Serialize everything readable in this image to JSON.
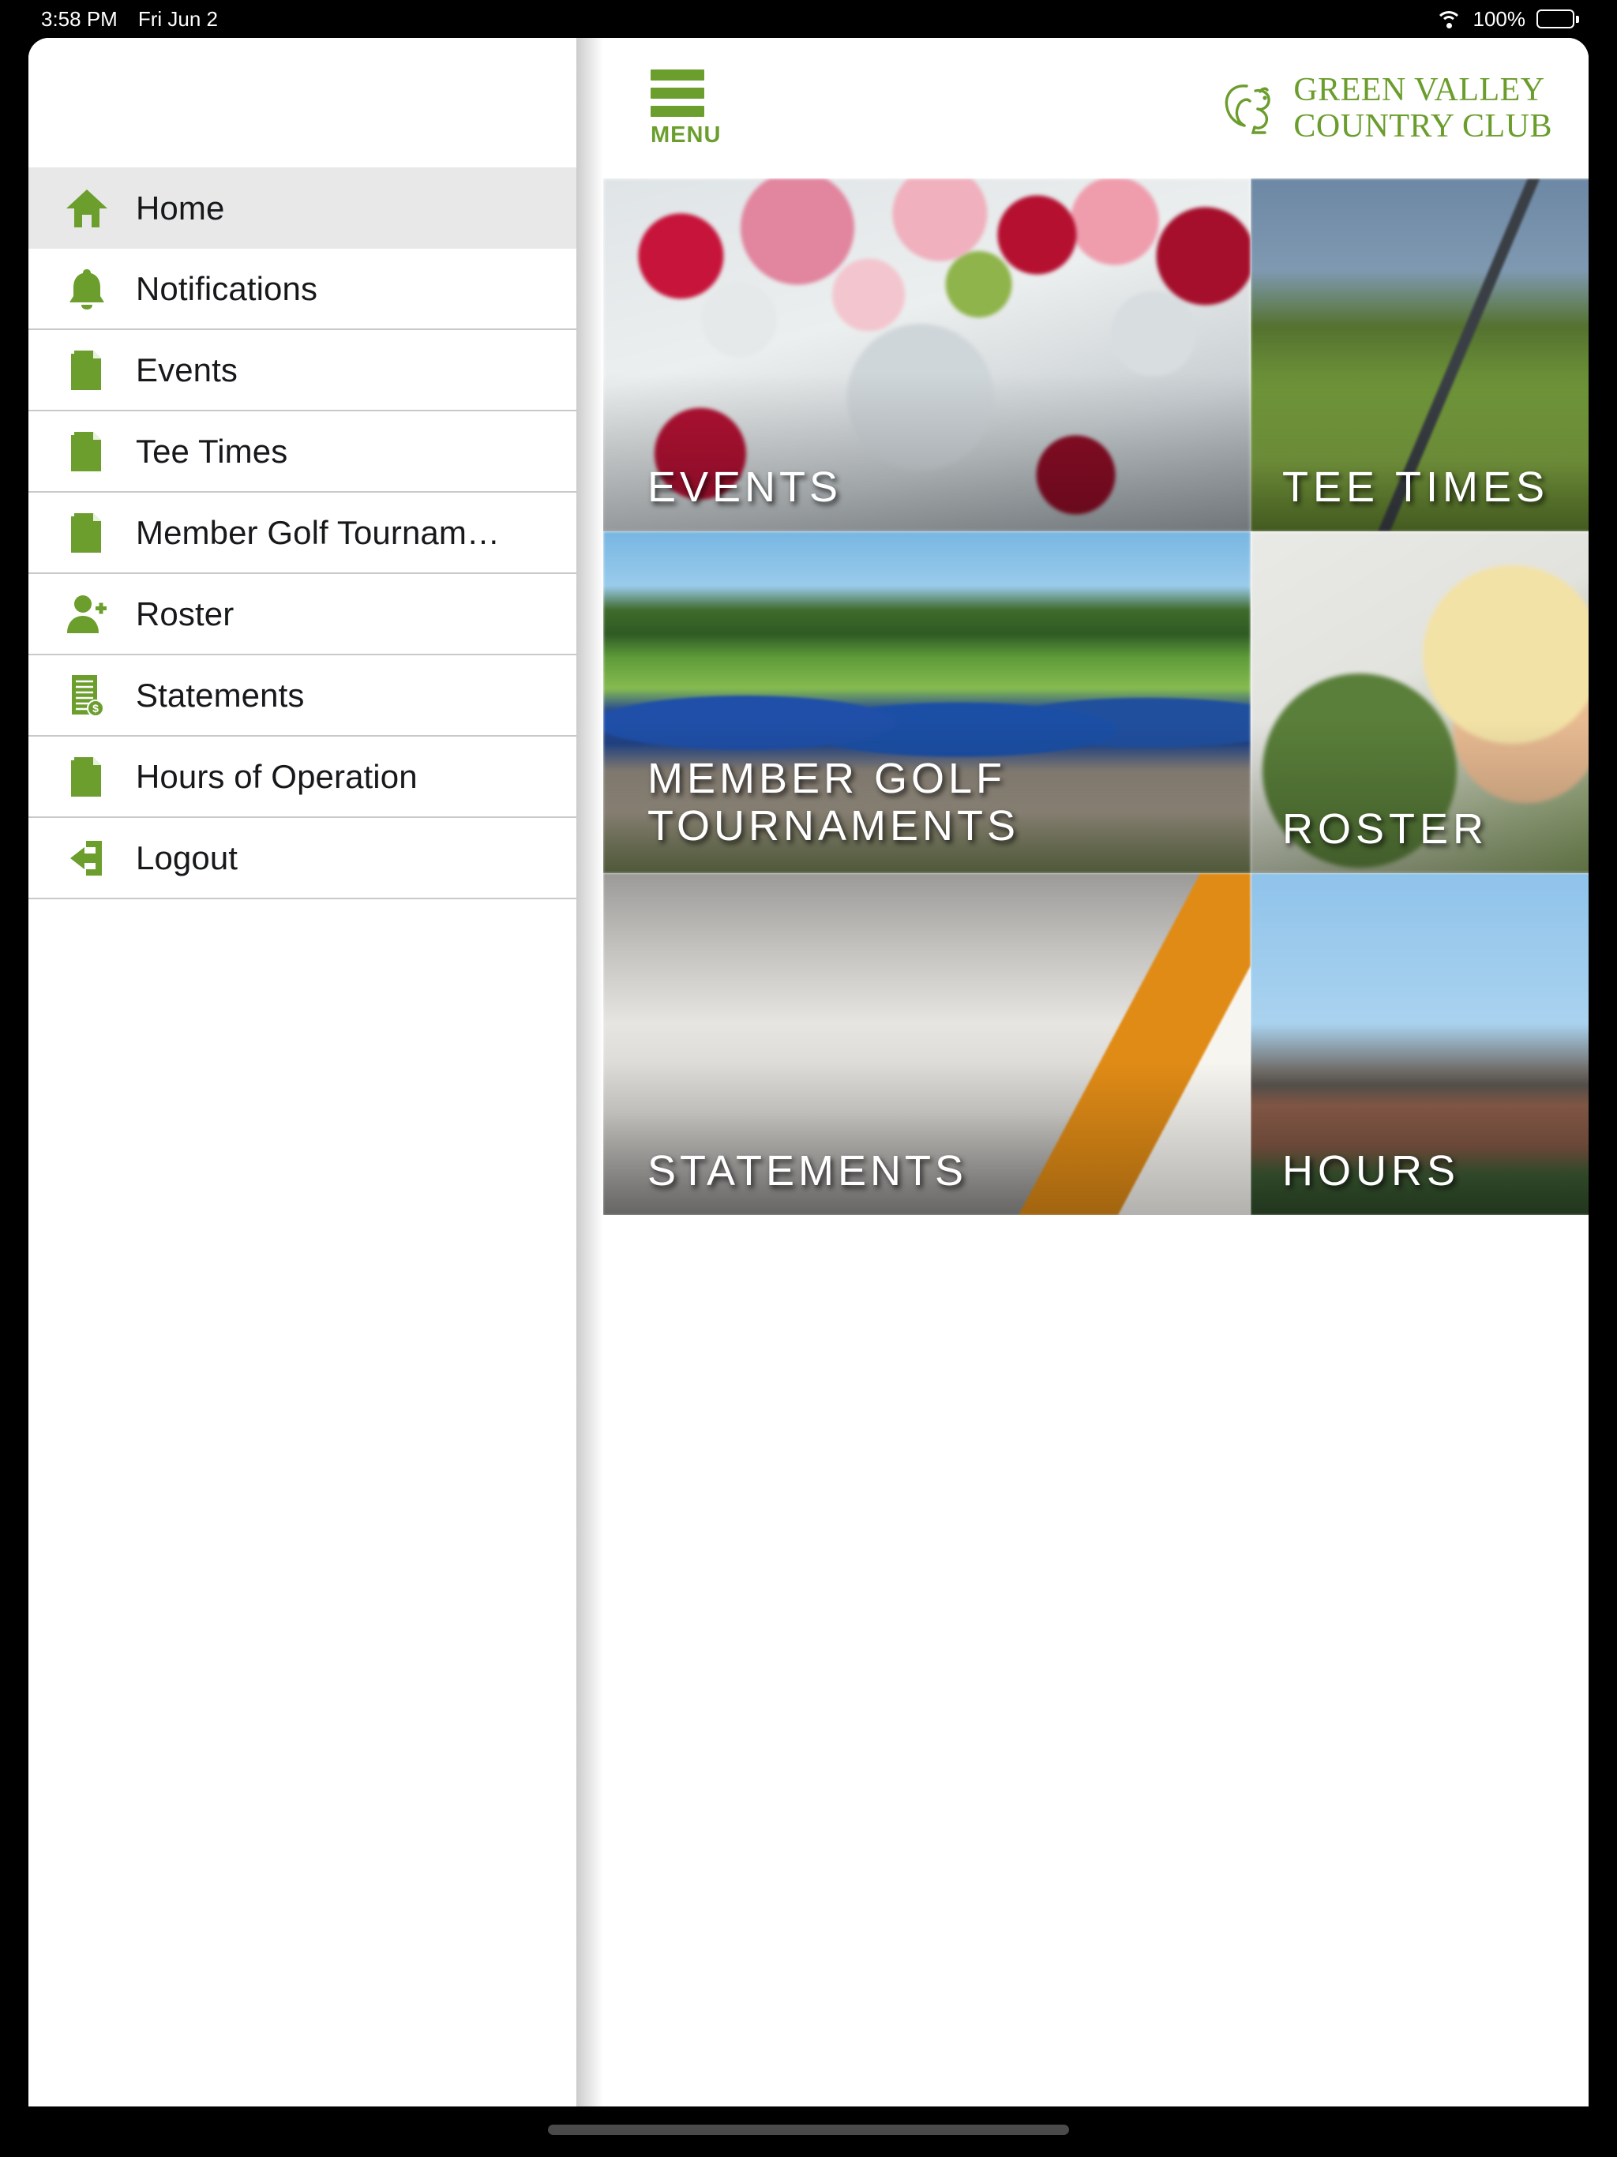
{
  "status_bar": {
    "time": "3:58 PM",
    "date": "Fri Jun 2",
    "battery_percent": "100%",
    "wifi_icon": "wifi-icon",
    "battery_icon": "battery-full-icon"
  },
  "sidebar": {
    "items": [
      {
        "label": "Home",
        "icon": "home-icon",
        "active": true
      },
      {
        "label": "Notifications",
        "icon": "bell-icon",
        "active": false
      },
      {
        "label": "Events",
        "icon": "document-icon",
        "active": false
      },
      {
        "label": "Tee Times",
        "icon": "document-icon",
        "active": false
      },
      {
        "label": "Member Golf Tournam…",
        "icon": "document-icon",
        "active": false
      },
      {
        "label": "Roster",
        "icon": "person-add-icon",
        "active": false
      },
      {
        "label": "Statements",
        "icon": "invoice-icon",
        "active": false
      },
      {
        "label": "Hours of Operation",
        "icon": "document-icon",
        "active": false
      },
      {
        "label": "Logout",
        "icon": "logout-icon",
        "active": false
      }
    ]
  },
  "header": {
    "menu_button_label": "MENU",
    "menu_icon": "hamburger-icon",
    "brand_line1": "GREEN VALLEY",
    "brand_line2": "COUNTRY CLUB",
    "brand_icon": "squirrel-logo-icon"
  },
  "tiles": [
    {
      "label": "EVENTS",
      "name": "tile-events"
    },
    {
      "label": "TEE TIMES",
      "name": "tile-tee-times"
    },
    {
      "label": "MEMBER GOLF\nTOURNAMENTS",
      "name": "tile-member-golf-tournaments"
    },
    {
      "label": "ROSTER",
      "name": "tile-roster"
    },
    {
      "label": "STATEMENTS",
      "name": "tile-statements"
    },
    {
      "label": "HOURS",
      "name": "tile-hours"
    }
  ],
  "colors": {
    "brand_green": "#6b9d2d",
    "menu_green": "#6c9e2e",
    "active_row": "#e8e8e8",
    "divider": "#c9c9c9"
  }
}
